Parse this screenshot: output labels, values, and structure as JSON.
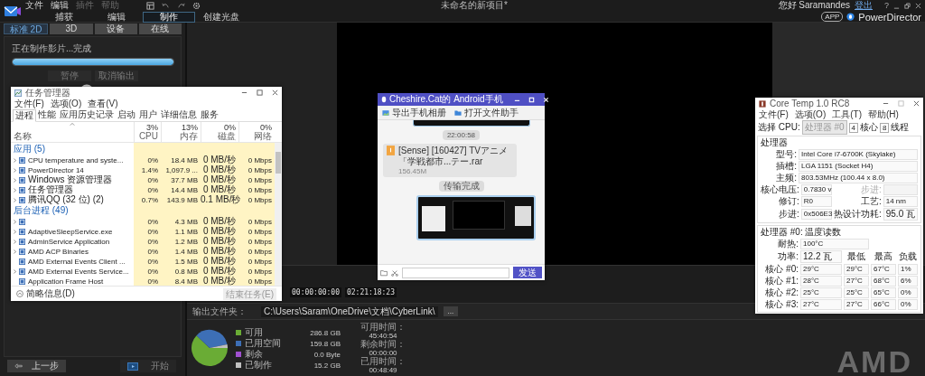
{
  "app": {
    "menu": [
      {
        "label": "文件",
        "disabled": false
      },
      {
        "label": "编辑",
        "disabled": false
      },
      {
        "label": "插件",
        "disabled": true
      },
      {
        "label": "帮助",
        "disabled": true
      }
    ],
    "title": "未命名的新项目*",
    "greeting": "您好 Saramandes",
    "account_link": "登出",
    "help": "?",
    "app_badge": "APP",
    "brand": "PowerDirector"
  },
  "mode_tabs": [
    {
      "label": "捕获",
      "selected": false
    },
    {
      "label": "编辑",
      "selected": false
    },
    {
      "label": "制作",
      "selected": true
    },
    {
      "label": "创建光盘",
      "selected": false
    }
  ],
  "produce": {
    "tabs": [
      {
        "label": "标准 2D",
        "selected": true
      },
      {
        "label": "3D",
        "selected": false
      },
      {
        "label": "设备",
        "selected": false
      },
      {
        "label": "在线",
        "selected": false
      }
    ],
    "status": "正在制作影片...完成",
    "level": 1,
    "buttons": [
      {
        "label": "暂停",
        "disabled": true
      },
      {
        "label": "取消输出",
        "disabled": true
      }
    ],
    "back": "上一步",
    "start": {
      "label": "开始",
      "disabled": true
    }
  },
  "preview": {
    "timecodes": [
      "00:00:00:00",
      "02:21:18:23"
    ]
  },
  "output": {
    "label": "输出文件夹：",
    "path": "C:\\Users\\Saram\\OneDrive\\文档\\CyberLink\\",
    "browse": "..."
  },
  "storage": {
    "chart_data": {
      "type": "pie",
      "categories": [
        "可用",
        "已用空间",
        "剩余",
        "已制作"
      ],
      "values": [
        62.1,
        34.6,
        0,
        3.3
      ]
    },
    "legend": [
      {
        "color": "#6aac35",
        "amount": "286.8 GB"
      },
      {
        "color": "#3d6fb6",
        "amount": "159.8 GB"
      },
      {
        "color": "#a050d0",
        "amount": "0.0 Byte"
      },
      {
        "color": "#c0c0c0",
        "amount": "15.2 GB"
      }
    ],
    "times": [
      {
        "label": "可用时间：",
        "value": "45:40:54"
      },
      {
        "label": "剩余时间：",
        "value": "00:00:00"
      },
      {
        "label": "已用时间：",
        "value": "00:48:49"
      }
    ]
  },
  "task_manager": {
    "title": "任务管理器",
    "menu": [
      "文件(F)",
      "选项(O)",
      "查看(V)"
    ],
    "tabs": [
      {
        "label": "进程",
        "selected": true
      },
      {
        "label": "性能",
        "selected": false
      },
      {
        "label": "应用历史记录",
        "selected": false
      },
      {
        "label": "启动",
        "selected": false
      },
      {
        "label": "用户",
        "selected": false
      },
      {
        "label": "详细信息",
        "selected": false
      },
      {
        "label": "服务",
        "selected": false
      }
    ],
    "name_column": "名称",
    "columns": [
      {
        "percent": "3%",
        "label": "CPU"
      },
      {
        "percent": "13%",
        "label": "内存"
      },
      {
        "percent": "0%",
        "label": "磁盘"
      },
      {
        "percent": "0%",
        "label": "网络"
      }
    ],
    "groups": [
      {
        "title": "应用 (5)",
        "rows": [
          {
            "name": "CPU temperature and syste...",
            "expandable": true,
            "cpu": "0%",
            "mem": "18.4 MB",
            "disk": "0 MB/秒",
            "net": "0 Mbps"
          },
          {
            "name": "PowerDirector 14",
            "expandable": true,
            "cpu": "1.4%",
            "mem": "1,097.9 ...",
            "disk": "0 MB/秒",
            "net": "0 Mbps"
          },
          {
            "name": "Windows 资源管理器",
            "expandable": true,
            "cpu": "0%",
            "mem": "37.7 MB",
            "disk": "0 MB/秒",
            "net": "0 Mbps"
          },
          {
            "name": "任务管理器",
            "expandable": true,
            "cpu": "0%",
            "mem": "14.4 MB",
            "disk": "0 MB/秒",
            "net": "0 Mbps"
          },
          {
            "name": "腾讯QQ (32 位) (2)",
            "expandable": true,
            "cpu": "0.7%",
            "mem": "143.9 MB",
            "disk": "0.1 MB/秒",
            "net": "0 Mbps"
          }
        ]
      },
      {
        "title": "后台进程 (49)",
        "rows": [
          {
            "expandable": true,
            "cpu": "0%",
            "mem": "4.3 MB",
            "disk": "0 MB/秒",
            "net": "0 Mbps"
          },
          {
            "name": "AdaptiveSleepService.exe",
            "expandable": true,
            "cpu": "0%",
            "mem": "1.1 MB",
            "disk": "0 MB/秒",
            "net": "0 Mbps"
          },
          {
            "name": "AdminService Application",
            "expandable": true,
            "cpu": "0%",
            "mem": "1.2 MB",
            "disk": "0 MB/秒",
            "net": "0 Mbps"
          },
          {
            "name": "AMD ACP Binaries",
            "expandable": true,
            "cpu": "0%",
            "mem": "1.4 MB",
            "disk": "0 MB/秒",
            "net": "0 Mbps"
          },
          {
            "name": "AMD External Events Client ...",
            "expandable": false,
            "cpu": "0%",
            "mem": "1.5 MB",
            "disk": "0 MB/秒",
            "net": "0 Mbps"
          },
          {
            "name": "AMD External Events Service...",
            "expandable": true,
            "cpu": "0%",
            "mem": "0.8 MB",
            "disk": "0 MB/秒",
            "net": "0 Mbps"
          },
          {
            "name": "Application Frame Host",
            "expandable": false,
            "cpu": "0%",
            "mem": "8.4 MB",
            "disk": "0 MB/秒",
            "net": "0 Mbps"
          }
        ]
      }
    ],
    "footer": "简略信息(D)",
    "end_task": {
      "label": "结束任务(E)",
      "disabled": true
    }
  },
  "qq": {
    "title": "Cheshire.Cat的 Android手机",
    "toolbar": [
      "导出手机相册",
      "打开文件助手"
    ],
    "messages": [
      {
        "kind": "image_tail"
      },
      {
        "kind": "time",
        "text": "22:00:58"
      },
      {
        "kind": "file",
        "name": "[Sense] [160427] TVアニメ「学戦都市...テー.rar",
        "size": "156.45M"
      },
      {
        "kind": "time",
        "text": "传输完成"
      },
      {
        "kind": "image"
      }
    ],
    "send": "发送"
  },
  "core_temp": {
    "title": "Core Temp 1.0 RC8",
    "menu": [
      "文件(F)",
      "选项(O)",
      "工具(T)",
      "帮助(H)"
    ],
    "cpu_label": "选择 CPU:",
    "cpu_select": {
      "value": "处理器 #0",
      "disabled": true
    },
    "cores": {
      "value": "4",
      "label": "核心"
    },
    "threads": {
      "value": "8",
      "label": "线程"
    },
    "section": "处理器",
    "fields": [
      {
        "label": "型号:",
        "value": "Intel Core i7-6700K (Skylake)"
      },
      {
        "label": "插槽:",
        "value": "LGA 1151 (Socket H4)"
      },
      {
        "label": "主频:",
        "value": "803.53MHz (100.44 x 8.0)"
      }
    ],
    "pairs": [
      {
        "label": "核心电压:",
        "value": "0.7830 v",
        "disabled": false
      },
      {
        "label": "步进:",
        "disabled": true
      },
      {
        "label": "修订:",
        "value": "R0",
        "disabled": false
      },
      {
        "label": "工艺:",
        "value": "14 nm",
        "disabled": false
      },
      {
        "label": "步进:",
        "value": "0x506E3",
        "disabled": false
      },
      {
        "label": "热设计功耗:",
        "value": "95.0 瓦",
        "disabled": false
      }
    ],
    "readings_title": "处理器 #0: 温度读数",
    "tjmax": {
      "label": "耐热:",
      "value": "100°C"
    },
    "power": {
      "label": "功率:",
      "value": "12.2 瓦"
    },
    "headers": [
      "最低",
      "最高",
      "负载"
    ],
    "core_rows": [
      {
        "label": "核心 #0:",
        "temp": "29°C",
        "min": "29°C",
        "max": "67°C",
        "load": "1%"
      },
      {
        "label": "核心 #1:",
        "temp": "28°C",
        "min": "27°C",
        "max": "68°C",
        "load": "6%"
      },
      {
        "label": "核心 #2:",
        "temp": "25°C",
        "min": "25°C",
        "max": "65°C",
        "load": "0%"
      },
      {
        "label": "核心 #3:",
        "temp": "27°C",
        "min": "27°C",
        "max": "66°C",
        "load": "0%"
      }
    ]
  },
  "desktop": {
    "logo": "AMD"
  }
}
